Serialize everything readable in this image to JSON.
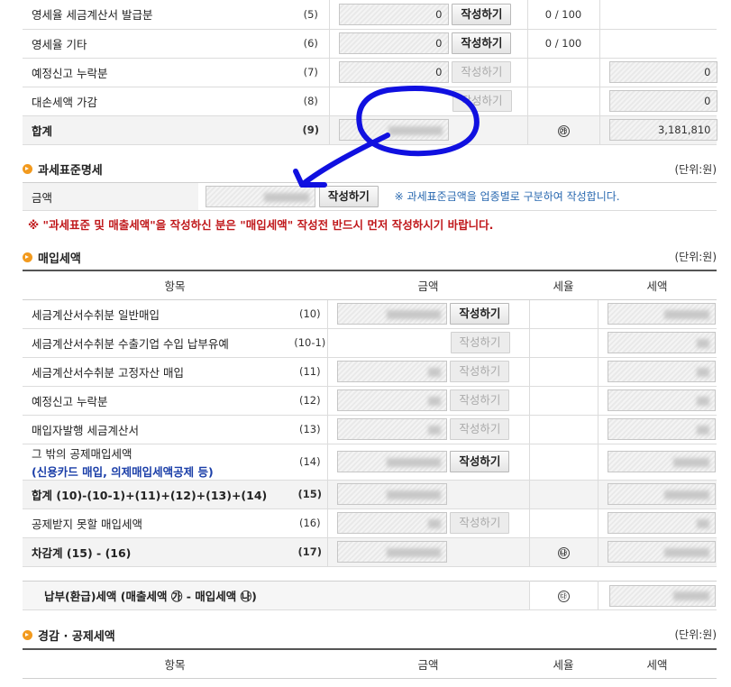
{
  "sales_section": {
    "rows": [
      {
        "label": "영세율 세금계산서 발급분",
        "code": "(5)",
        "amount": "0",
        "button": "작성하기",
        "rate": "0 / 100"
      },
      {
        "label": "영세율 기타",
        "code": "(6)",
        "amount": "0",
        "button": "작성하기",
        "rate": "0 / 100"
      },
      {
        "label": "예정신고 누락분",
        "code": "(7)",
        "amount": "0",
        "button": "작성하기",
        "tax": "0"
      },
      {
        "label": "대손세액 가감",
        "code": "(8)",
        "button": "작성하기",
        "tax": "0"
      },
      {
        "label": "합계",
        "code": "(9)",
        "mark": "㉮",
        "tax": "3,181,810"
      }
    ]
  },
  "tax_base": {
    "title": "과세표준명세",
    "unit": "(단위:원)",
    "amount_label": "금액",
    "button": "작성하기",
    "hint": "※ 과세표준금액을 업종별로 구분하여 작성합니다.",
    "notice": "※ \"과세표준 및 매출세액\"을 작성하신 분은 \"매입세액\" 작성전 반드시 먼저 작성하시기 바랍니다."
  },
  "purchase": {
    "title": "매입세액",
    "unit": "(단위:원)",
    "headers": [
      "항목",
      "금액",
      "세율",
      "세액"
    ],
    "rows": [
      {
        "label": "세금계산서수취분 일반매입",
        "code": "(10)",
        "button": "작성하기",
        "enabled": true
      },
      {
        "label": "세금계산서수취분 수출기업 수입 납부유예",
        "code": "(10-1)",
        "button": "작성하기",
        "enabled": false
      },
      {
        "label": "세금계산서수취분 고정자산 매입",
        "code": "(11)",
        "button": "작성하기",
        "enabled": false
      },
      {
        "label": "예정신고 누락분",
        "code": "(12)",
        "button": "작성하기",
        "enabled": false
      },
      {
        "label": "매입자발행 세금계산서",
        "code": "(13)",
        "button": "작성하기",
        "enabled": false
      },
      {
        "label": "그 밖의 공제매입세액",
        "sublabel": "(신용카드 매입, 의제매입세액공제 등)",
        "code": "(14)",
        "button": "작성하기",
        "enabled": true
      },
      {
        "label": "합계 (10)-(10-1)+(11)+(12)+(13)+(14)",
        "code": "(15)"
      },
      {
        "label": "공제받지 못할 매입세액",
        "code": "(16)",
        "button": "작성하기",
        "enabled": false
      },
      {
        "label": "차감계 (15) - (16)",
        "code": "(17)",
        "mark": "㉯"
      }
    ]
  },
  "payable": {
    "label": "납부(환급)세액 (매출세액 ㉮ - 매입세액 ㉯)",
    "mark": "㉰"
  },
  "reduction": {
    "title": "경감 · 공제세액",
    "unit": "(단위:원)",
    "headers": [
      "항목",
      "금액",
      "세율",
      "세액"
    ]
  },
  "colors": {
    "accent_orange": "#f29a1e",
    "notice_red": "#c0181b",
    "hint_blue": "#2a69b0",
    "sub_blue": "#1a3ea8",
    "annotation_blue": "#1010e0"
  }
}
